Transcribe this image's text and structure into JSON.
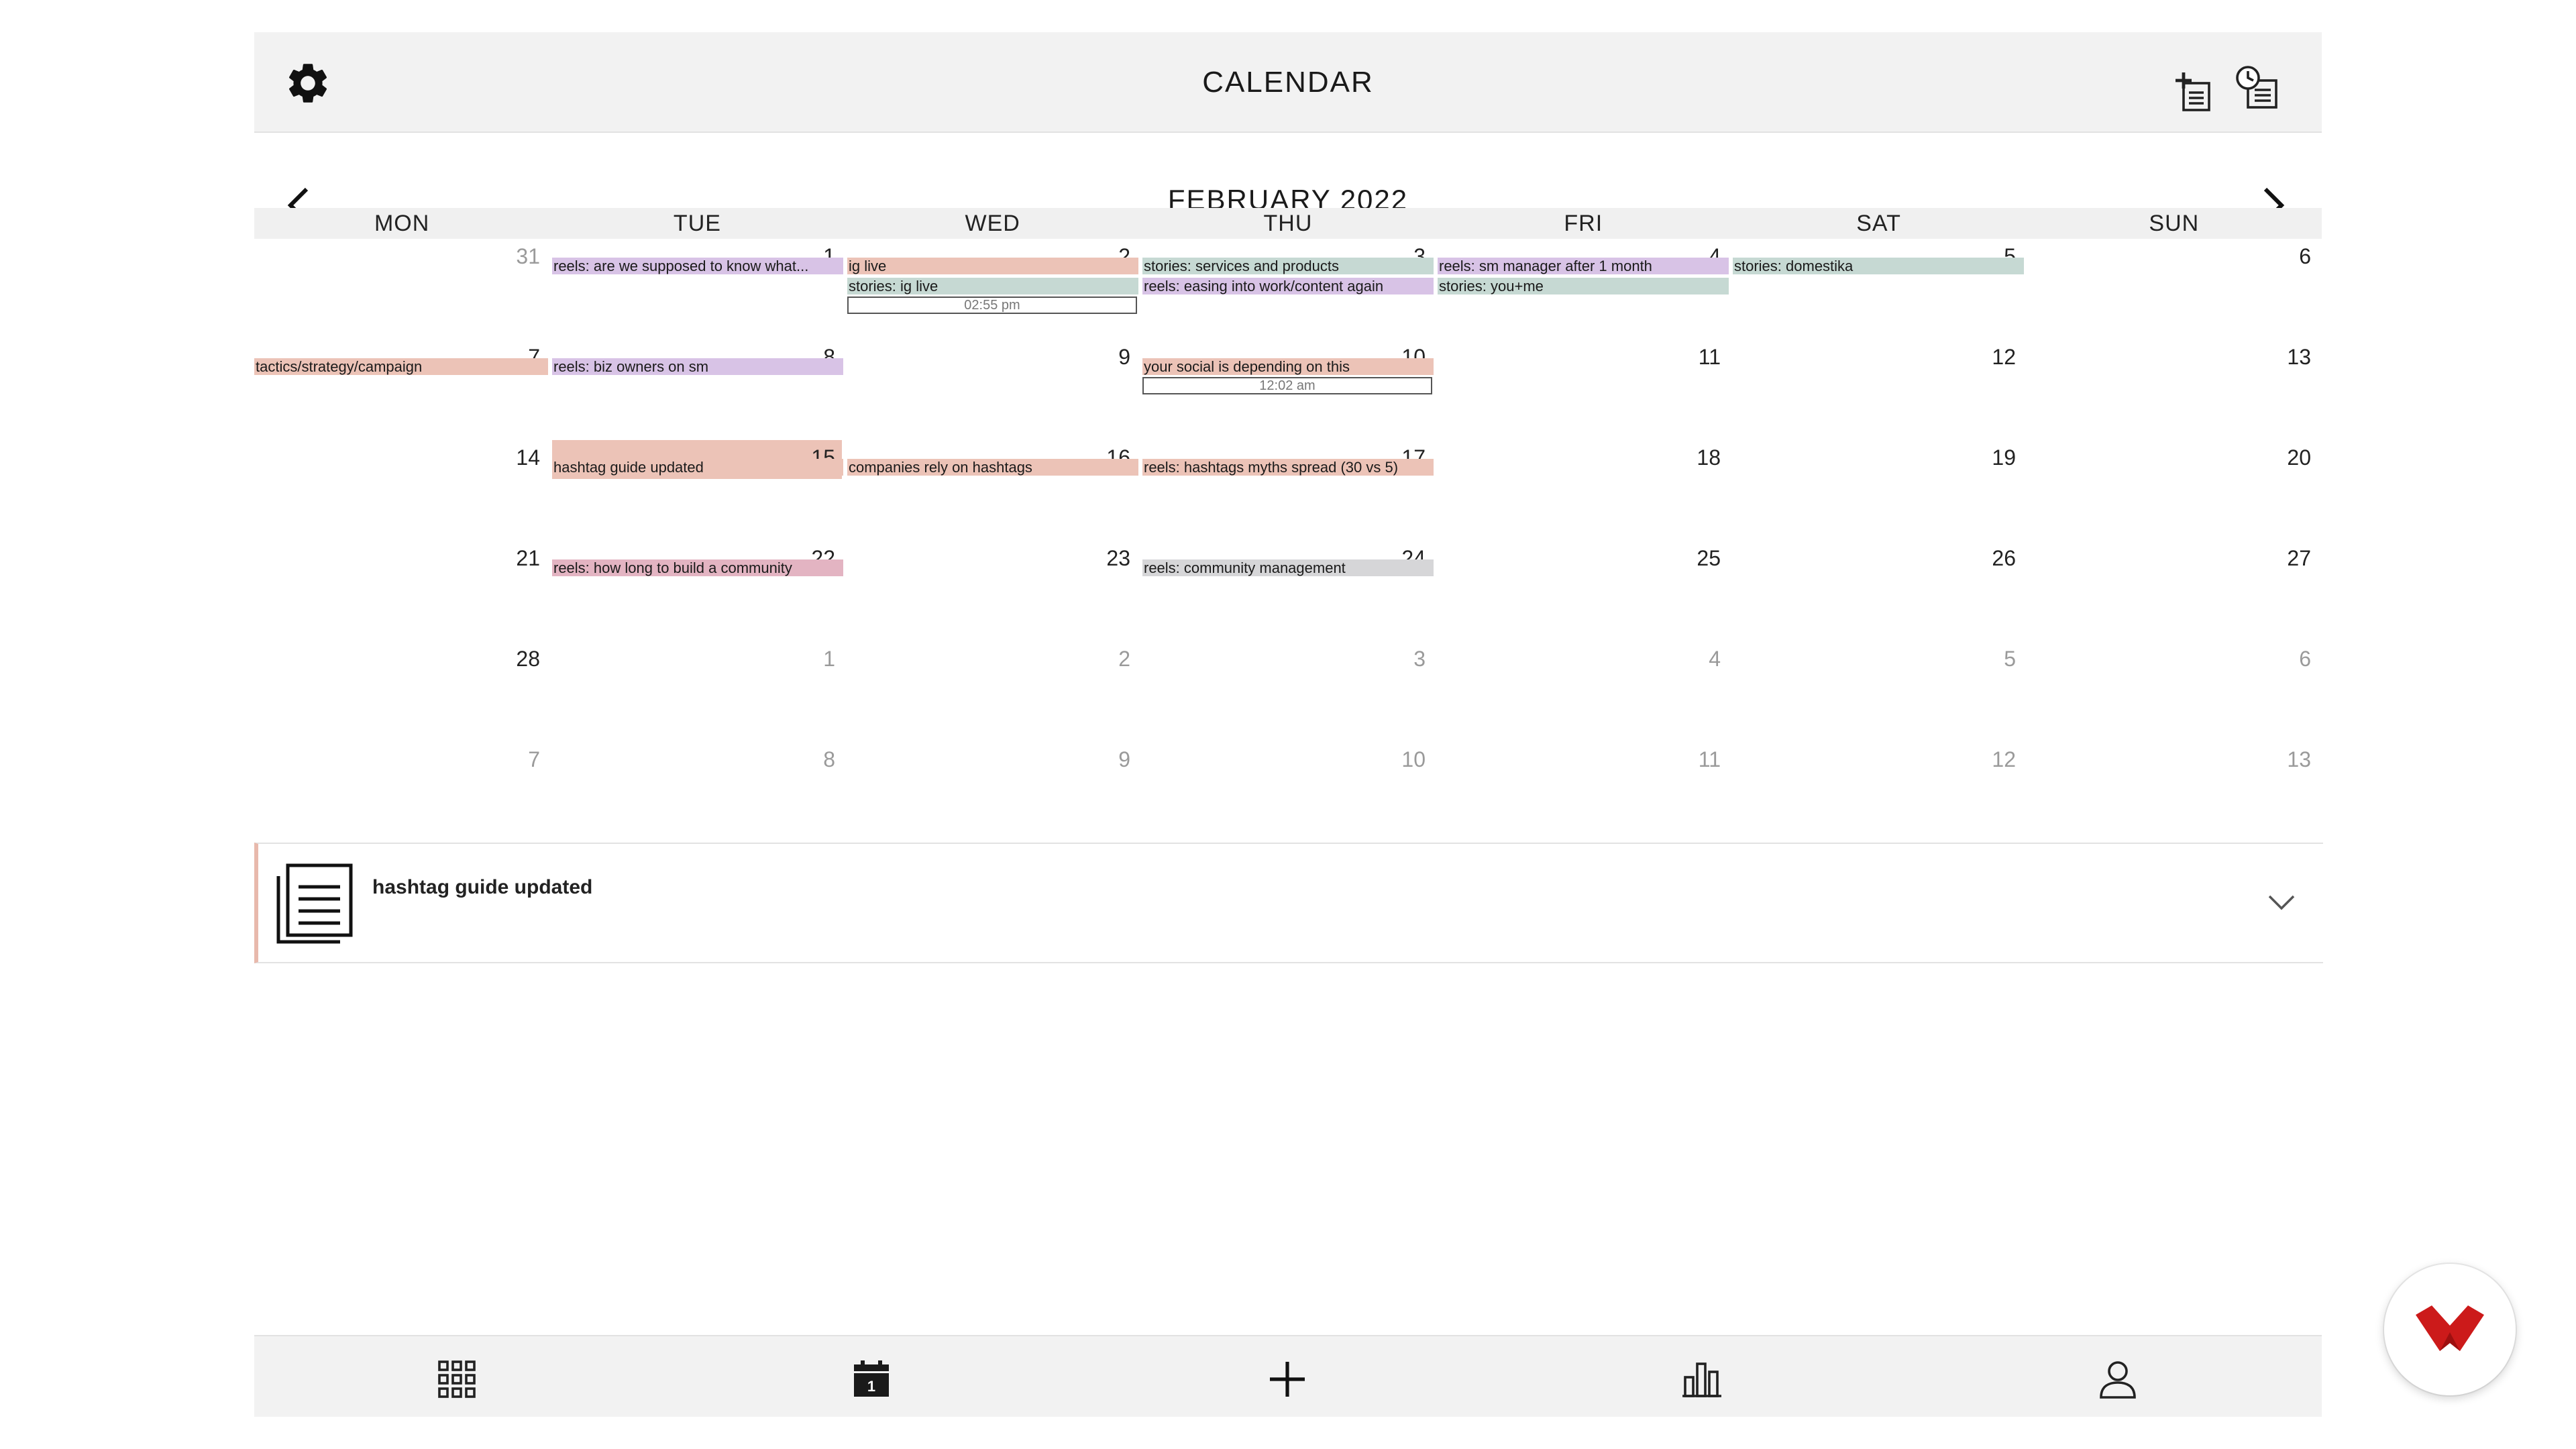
{
  "header": {
    "title": "CALENDAR"
  },
  "month_nav": {
    "title": "FEBRUARY 2022"
  },
  "weekdays": [
    "MON",
    "TUE",
    "WED",
    "THU",
    "FRI",
    "SAT",
    "SUN"
  ],
  "weeks": [
    [
      {
        "num": "31",
        "other": true
      },
      {
        "num": "1"
      },
      {
        "num": "2"
      },
      {
        "num": "3"
      },
      {
        "num": "4"
      },
      {
        "num": "5"
      },
      {
        "num": "6"
      }
    ],
    [
      {
        "num": "7"
      },
      {
        "num": "8"
      },
      {
        "num": "9"
      },
      {
        "num": "10"
      },
      {
        "num": "11"
      },
      {
        "num": "12"
      },
      {
        "num": "13"
      }
    ],
    [
      {
        "num": "14"
      },
      {
        "num": "15",
        "highlight": true
      },
      {
        "num": "16"
      },
      {
        "num": "17"
      },
      {
        "num": "18"
      },
      {
        "num": "19"
      },
      {
        "num": "20"
      }
    ],
    [
      {
        "num": "21"
      },
      {
        "num": "22"
      },
      {
        "num": "23"
      },
      {
        "num": "24"
      },
      {
        "num": "25"
      },
      {
        "num": "26"
      },
      {
        "num": "27"
      }
    ],
    [
      {
        "num": "28"
      },
      {
        "num": "1",
        "other": true
      },
      {
        "num": "2",
        "other": true
      },
      {
        "num": "3",
        "other": true
      },
      {
        "num": "4",
        "other": true
      },
      {
        "num": "5",
        "other": true
      },
      {
        "num": "6",
        "other": true
      }
    ],
    [
      {
        "num": "7",
        "other": true
      },
      {
        "num": "8",
        "other": true
      },
      {
        "num": "9",
        "other": true
      },
      {
        "num": "10",
        "other": true
      },
      {
        "num": "11",
        "other": true
      },
      {
        "num": "12",
        "other": true
      },
      {
        "num": "13",
        "other": true
      }
    ]
  ],
  "events": [
    {
      "week": 0,
      "col": 1,
      "row": 0,
      "label": "reels: are we supposed to know what...",
      "color": "#d8c3e6"
    },
    {
      "week": 0,
      "col": 2,
      "row": 0,
      "label": "ig live",
      "color": "#ecc3b7"
    },
    {
      "week": 0,
      "col": 2,
      "row": 1,
      "label": "stories: ig live",
      "color": "#c6d9d3"
    },
    {
      "week": 0,
      "col": 3,
      "row": 0,
      "label": "stories: services and products",
      "color": "#c6d9d3"
    },
    {
      "week": 0,
      "col": 3,
      "row": 1,
      "label": "reels: easing into work/content again",
      "color": "#d8c3e6"
    },
    {
      "week": 0,
      "col": 4,
      "row": 0,
      "label": "reels: sm manager after 1 month",
      "color": "#d8c3e6"
    },
    {
      "week": 0,
      "col": 4,
      "row": 1,
      "label": "stories: you+me",
      "color": "#c6d9d3"
    },
    {
      "week": 0,
      "col": 5,
      "row": 0,
      "label": "stories: domestika",
      "color": "#c6d9d3"
    },
    {
      "week": 1,
      "col": 0,
      "row": 0,
      "label": "tactics/strategy/campaign",
      "color": "#ecc3b7",
      "cut": true
    },
    {
      "week": 1,
      "col": 1,
      "row": 0,
      "label": "reels: biz owners on sm",
      "color": "#d8c3e6"
    },
    {
      "week": 1,
      "col": 3,
      "row": 0,
      "label": "your social is depending on this",
      "color": "#ecc3b7"
    },
    {
      "week": 2,
      "col": 1,
      "row": 0,
      "label": "hashtag guide updated",
      "color": "#ecc3b7"
    },
    {
      "week": 2,
      "col": 2,
      "row": 0,
      "label": "companies rely on hashtags",
      "color": "#ecc3b7"
    },
    {
      "week": 2,
      "col": 3,
      "row": 0,
      "label": "reels: hashtags myths spread (30 vs 5)",
      "color": "#ecc3b7"
    },
    {
      "week": 3,
      "col": 1,
      "row": 0,
      "label": "reels: how long to build a community",
      "color": "#e3b4c2"
    },
    {
      "week": 3,
      "col": 3,
      "row": 0,
      "label": "reels: community management",
      "color": "#d6d6d8"
    }
  ],
  "time_boxes": [
    {
      "week": 0,
      "col": 2,
      "row": 2,
      "label": "02:55 pm"
    },
    {
      "week": 1,
      "col": 3,
      "row": 1,
      "label": "12:02 am"
    }
  ],
  "detail": {
    "title": "hashtag guide updated",
    "accent": "#e8b9ac"
  },
  "icons": {
    "settings": "gear-icon",
    "add_note": "add-note-icon",
    "schedule": "clock-list-icon",
    "prev": "chevron-left-icon",
    "next": "chevron-right-icon",
    "detail_doc": "document-stack-icon",
    "expand": "chevron-down-icon",
    "nav": [
      "grid-icon",
      "calendar-icon",
      "plus-icon",
      "bar-chart-icon",
      "user-icon"
    ],
    "fab": "brand-logo-icon"
  },
  "bottom_nav": {
    "calendar_day": "1"
  },
  "colors": {
    "accent": "#cc1a1a"
  }
}
